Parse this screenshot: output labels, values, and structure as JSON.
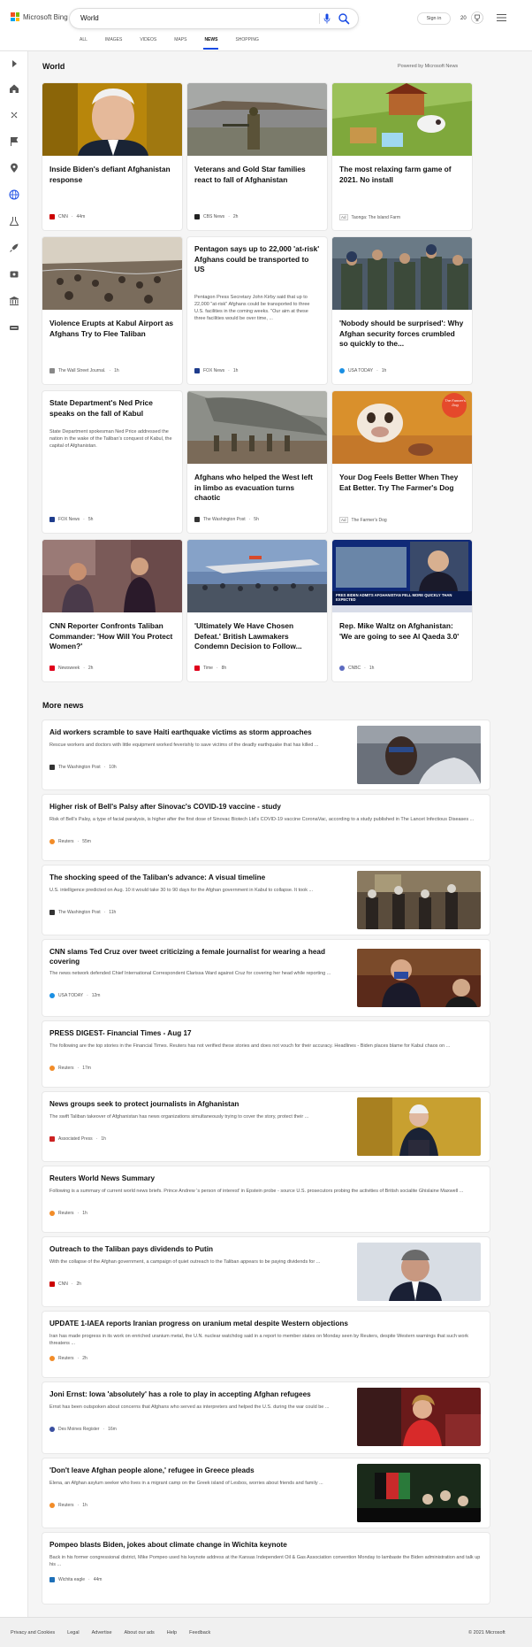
{
  "header": {
    "logo_text": "Microsoft Bing",
    "search_value": "World",
    "signin_label": "Sign in",
    "rewards_count": "20"
  },
  "nav": {
    "tabs": [
      "ALL",
      "IMAGES",
      "VIDEOS",
      "MAPS",
      "NEWS",
      "SHOPPING"
    ],
    "active": "NEWS"
  },
  "section": {
    "title": "World",
    "powered_by": "Powered by Microsoft News"
  },
  "cards": [
    {
      "title": "Inside Biden's defiant Afghanistan response",
      "desc": "",
      "source": "CNN",
      "time": "44m",
      "ad": false,
      "logo_color": "#cc0000"
    },
    {
      "title": "Veterans and Gold Star families react to fall of Afghanistan",
      "desc": "",
      "source": "CBS News",
      "time": "2h",
      "ad": false,
      "logo_color": "#222222"
    },
    {
      "title": "The most relaxing farm game of 2021. No install",
      "desc": "",
      "source": "Taonga: The Island Farm",
      "time": "",
      "ad": true,
      "ad_label": "Ad",
      "logo_color": ""
    },
    {
      "title": "Violence Erupts at Kabul Airport as Afghans Try to Flee Taliban",
      "desc": "",
      "source": "The Wall Street Journal.",
      "time": "1h",
      "ad": false,
      "logo_color": "#888888"
    },
    {
      "title": "Pentagon says up to 22,000 'at-risk' Afghans could be transported to US",
      "desc": "Pentagon Press Secretary John Kirby said that up to 22,000 \"at-risk\" Afghans could be transported to three U.S. facilities in the coming weeks. \"Our aim at these three facilities would be over time, ...",
      "source": "FOX News",
      "time": "1h",
      "ad": false,
      "logo_color": "#1e3c8c"
    },
    {
      "title": "'Nobody should be surprised': Why Afghan security forces crumbled so quickly to the...",
      "desc": "",
      "source": "USA TODAY",
      "time": "1h",
      "ad": false,
      "logo_color": "#1a8fe3"
    },
    {
      "title": "State Department's Ned Price speaks on the fall of Kabul",
      "desc": "State Department spokesman Ned Price addressed the nation in the wake of the Taliban's conquest of Kabul, the capital of Afghanistan.",
      "source": "FOX News",
      "time": "5h",
      "ad": false,
      "logo_color": "#1e3c8c"
    },
    {
      "title": "Afghans who helped the West left in limbo as evacuation turns chaotic",
      "desc": "",
      "source": "The Washington Post",
      "time": "5h",
      "ad": false,
      "logo_color": "#333333"
    },
    {
      "title": "Your Dog Feels Better When They Eat Better. Try The Farmer's Dog",
      "desc": "",
      "source": "The Farmer's Dog",
      "time": "",
      "ad": true,
      "ad_label": "Ad",
      "logo_color": ""
    },
    {
      "title": "CNN Reporter Confronts Taliban Commander: 'How Will You Protect Women?'",
      "desc": "",
      "source": "Newsweek",
      "time": "2h",
      "ad": false,
      "logo_color": "#e0001b"
    },
    {
      "title": "'Ultimately We Have Chosen Defeat.' British Lawmakers Condemn Decision to Follow...",
      "desc": "",
      "source": "Time",
      "time": "8h",
      "ad": false,
      "logo_color": "#e0001b"
    },
    {
      "title": "Rep. Mike Waltz on Afghanistan: 'We are going to see Al Qaeda 3.0'",
      "desc": "",
      "source": "CNBC",
      "time": "1h",
      "ad": false,
      "logo_color": "#5c6bc0"
    }
  ],
  "card_images": {
    "farmers_dog_badge": "The Farmer's Dog",
    "cnbc_banner": "PRES BIDEN ADMITS AFGHANISTAN FELL MORE QUICKLY THAN EXPECTED"
  },
  "more_news": {
    "title": "More news",
    "items": [
      {
        "title": "Aid workers scramble to save Haiti earthquake victims as storm approaches",
        "desc": "Rescue workers and doctors with little equipment worked feverishly to save victims of the deadly earthquake that has killed ...",
        "source": "The Washington Post",
        "time": "10h",
        "has_image": true,
        "logo_color": "#333333"
      },
      {
        "title": "Higher risk of Bell's Palsy after Sinovac's COVID-19 vaccine - study",
        "desc": "Risk of Bell's Palsy, a type of facial paralysis, is higher after the first dose of Sinovac Biotech Ltd's COVID-19 vaccine CoronaVac, according to a study published in The Lancet Infectious Diseases ...",
        "source": "Reuters",
        "time": "55m",
        "has_image": false,
        "logo_color": "#f28c28"
      },
      {
        "title": "The shocking speed of the Taliban's advance: A visual timeline",
        "desc": "U.S. intelligence predicted on Aug. 10 it would take 30 to 90 days for the Afghan government in Kabul to collapse. It took ...",
        "source": "The Washington Post",
        "time": "11h",
        "has_image": true,
        "logo_color": "#333333"
      },
      {
        "title": "CNN slams Ted Cruz over tweet criticizing a female journalist for wearing a head covering",
        "desc": "The news network defended Chief International Correspondent Clarissa Ward against Cruz for covering her head while reporting ...",
        "source": "USA TODAY",
        "time": "12m",
        "has_image": true,
        "logo_color": "#1a8fe3"
      },
      {
        "title": "PRESS DIGEST- Financial Times - Aug 17",
        "desc": "The following are the top stories in the Financial Times. Reuters has not verified these stories and does not vouch for their accuracy. Headlines - Biden places blame for Kabul chaos on ...",
        "source": "Reuters",
        "time": "17m",
        "has_image": false,
        "logo_color": "#f28c28"
      },
      {
        "title": "News groups seek to protect journalists in Afghanistan",
        "desc": "The swift Taliban takeover of Afghanistan has news organizations simultaneously trying to cover the story, protect their ...",
        "source": "Associated Press",
        "time": "1h",
        "has_image": true,
        "logo_color": "#cc2222"
      },
      {
        "title": "Reuters World News Summary",
        "desc": "Following is a summary of current world news briefs. Prince Andrew 's person of interest' in Epstein probe - source U.S. prosecutors probing the activities of British socialite Ghislaine Maxwell ...",
        "source": "Reuters",
        "time": "1h",
        "has_image": false,
        "logo_color": "#f28c28"
      },
      {
        "title": "Outreach to the Taliban pays dividends to Putin",
        "desc": "With the collapse of the Afghan government, a campaign of quiet outreach to the Taliban appears to be paying dividends for ...",
        "source": "CNN",
        "time": "2h",
        "has_image": true,
        "logo_color": "#cc0000"
      },
      {
        "title": "UPDATE 1-IAEA reports Iranian progress on uranium metal despite Western objections",
        "desc": "Iran has made progress in its work on enriched uranium metal, the U.N. nuclear watchdog said in a report to member states on Monday seen by Reuters, despite Western warnings that such work threatens ...",
        "source": "Reuters",
        "time": "2h",
        "has_image": false,
        "logo_color": "#f28c28"
      },
      {
        "title": "Joni Ernst: Iowa 'absolutely' has a role to play in accepting Afghan refugees",
        "desc": "Ernst has been outspoken about concerns that Afghans who served as interpreters and helped the U.S. during the war could be ...",
        "source": "Des Moines Register",
        "time": "16m",
        "has_image": true,
        "logo_color": "#3a4fa0"
      },
      {
        "title": "'Don't leave Afghan people alone,' refugee in Greece pleads",
        "desc": "Elena, an Afghan asylum seeker who lives in a migrant camp on the Greek island of Lesbos, worries about friends and family ...",
        "source": "Reuters",
        "time": "1h",
        "has_image": true,
        "logo_color": "#f28c28"
      },
      {
        "title": "Pompeo blasts Biden, jokes about climate change in Wichita keynote",
        "desc": "Back in his former congressional district, Mike Pompeo used his keynote address at the Kansas Independent Oil & Gas Association convention Monday to lambaste the Biden administration and talk up his ...",
        "source": "Wichita eagle",
        "time": "44m",
        "has_image": false,
        "logo_color": "#1d6fb8"
      }
    ]
  },
  "footer": {
    "links": [
      "Privacy and Cookies",
      "Legal",
      "Advertise",
      "About our ads",
      "Help",
      "Feedback"
    ],
    "copyright": "© 2021 Microsoft"
  },
  "colors": {
    "accent": "#174ae4",
    "ms_red": "#f25022",
    "ms_green": "#7fba00",
    "ms_blue": "#00a4ef",
    "ms_yellow": "#ffb900"
  }
}
